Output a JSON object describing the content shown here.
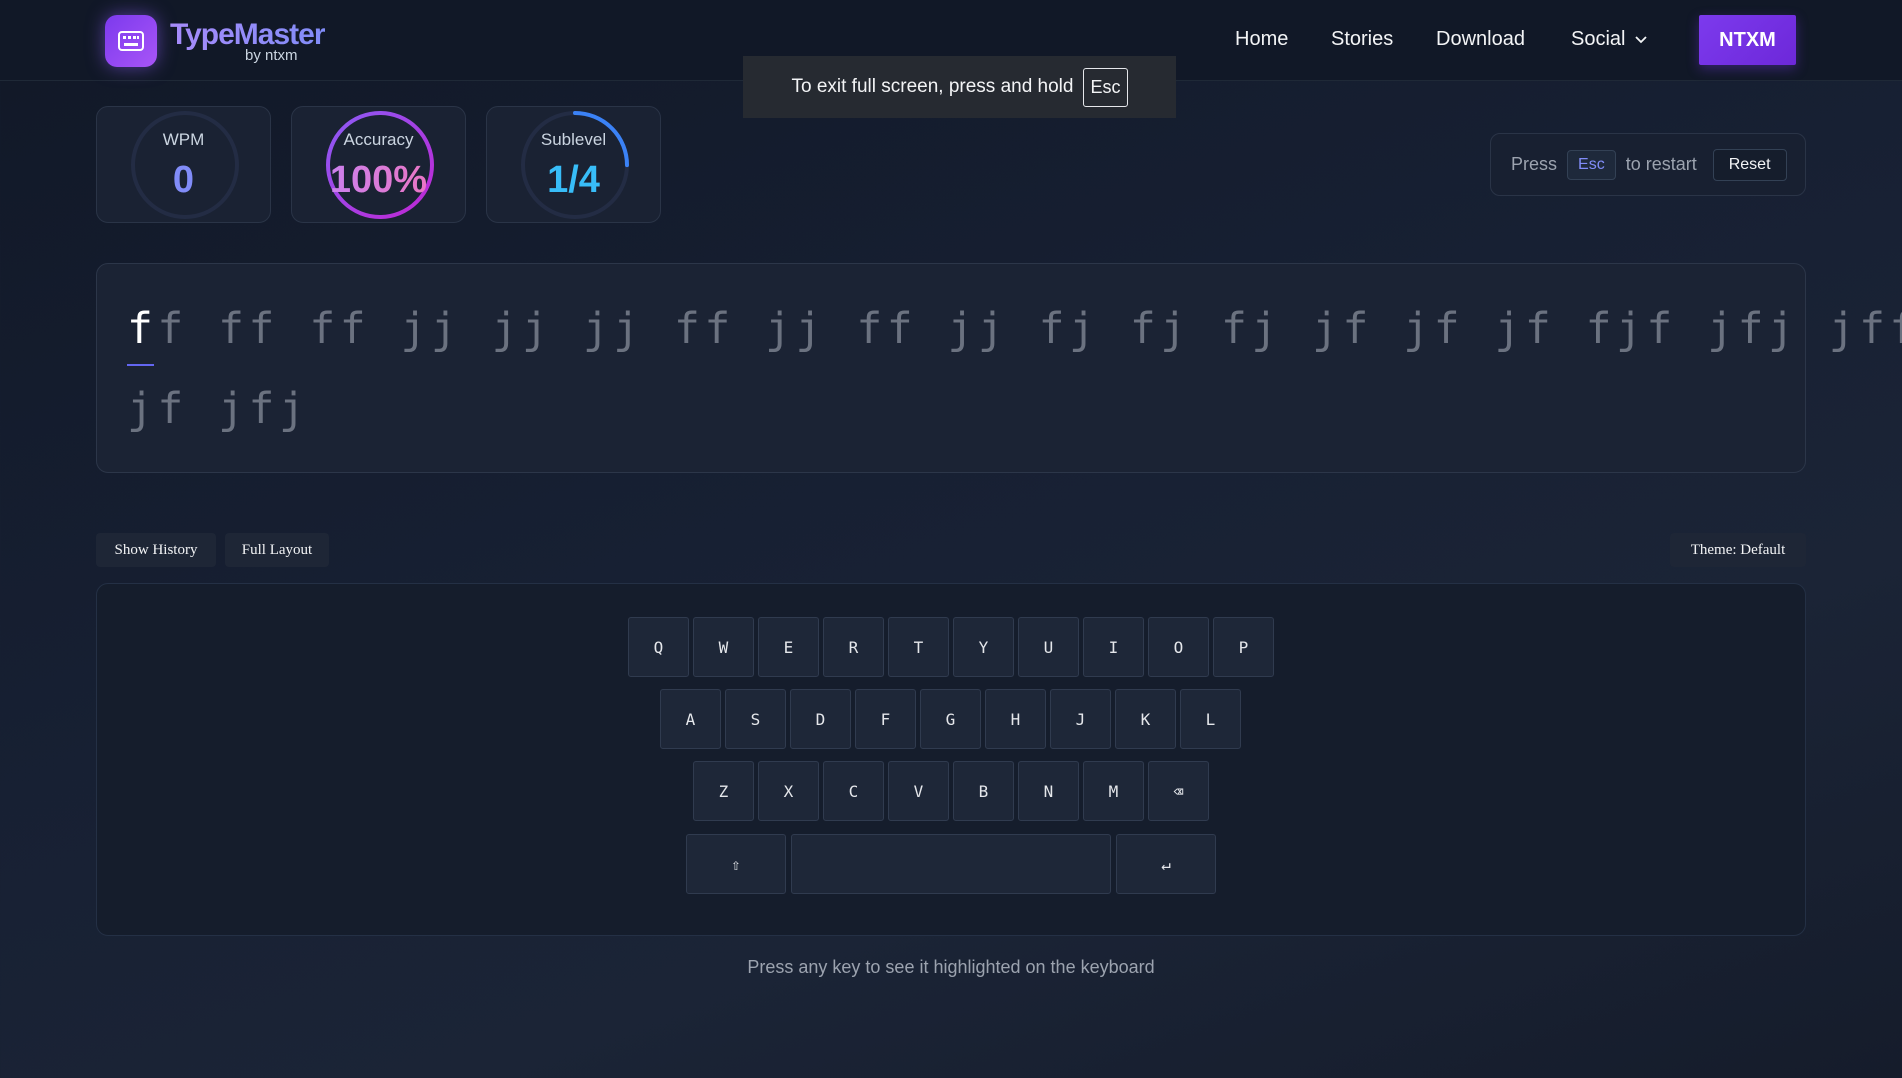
{
  "header": {
    "logo_title": "TypeMaster",
    "logo_sub": "by ntxm",
    "nav": [
      {
        "label": "Home"
      },
      {
        "label": "Stories"
      },
      {
        "label": "Download"
      },
      {
        "label": "Social"
      }
    ],
    "cta_label": "NTXM"
  },
  "toast": {
    "message": "To exit full screen, press and hold",
    "key": "Esc"
  },
  "stats": {
    "wpm": {
      "label": "WPM",
      "value": "0",
      "progress": 0
    },
    "accuracy": {
      "label": "Accuracy",
      "value": "100%",
      "progress": 1.0
    },
    "sublevel": {
      "label": "Sublevel",
      "value": "1/4",
      "progress": 0.25
    }
  },
  "restart": {
    "press": "Press",
    "key": "Esc",
    "suffix": "to restart",
    "reset_label": "Reset"
  },
  "typing": {
    "current_char": "f",
    "line1_rest": "f ff ff jj jj jj ff jj ff jj fj fj fj jf jf jf fjf jfj jff j",
    "line2": "jf jfj"
  },
  "toolbar": {
    "show_history": "Show History",
    "full_layout": "Full Layout",
    "theme": "Theme: Default"
  },
  "keyboard": {
    "row1": [
      "Q",
      "W",
      "E",
      "R",
      "T",
      "Y",
      "U",
      "I",
      "O",
      "P"
    ],
    "row2": [
      "A",
      "S",
      "D",
      "F",
      "G",
      "H",
      "J",
      "K",
      "L"
    ],
    "row3": [
      "Z",
      "X",
      "C",
      "V",
      "B",
      "N",
      "M",
      "⌫"
    ],
    "shift": "⇧",
    "space": "",
    "enter": "↵"
  },
  "hint": "Press any key to see it highlighted on the keyboard",
  "colors": {
    "accent": "#7c3aed",
    "wpm": "#818cf8",
    "accuracy_start": "#8b5cf6",
    "accuracy_end": "#ec4899",
    "sublevel": "#38bdf8"
  }
}
